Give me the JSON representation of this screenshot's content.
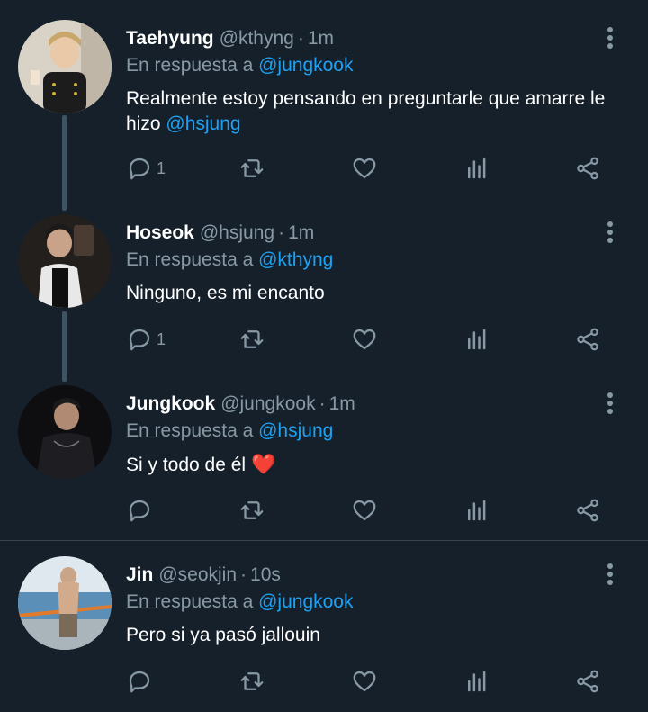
{
  "tweets": [
    {
      "name": "Taehyung",
      "handle": "@kthyng",
      "time": "1m",
      "reply_prefix": "En respuesta a",
      "reply_to": "@jungkook",
      "text_main": "Realmente estoy pensando en preguntarle que amarre le hizo",
      "text_mention": "@hsjung",
      "reply_count": "1"
    },
    {
      "name": "Hoseok",
      "handle": "@hsjung",
      "time": "1m",
      "reply_prefix": "En respuesta a",
      "reply_to": "@kthyng",
      "text_main": "Ninguno, es mi encanto",
      "reply_count": "1"
    },
    {
      "name": "Jungkook",
      "handle": "@jungkook",
      "time": "1m",
      "reply_prefix": "En respuesta a",
      "reply_to": "@hsjung",
      "text_main": "Si y todo de él",
      "emoji": "❤️"
    },
    {
      "name": "Jin",
      "handle": "@seokjin",
      "time": "10s",
      "reply_prefix": "En respuesta a",
      "reply_to": "@jungkook",
      "text_main": "Pero si ya pasó jallouin"
    }
  ],
  "separator": "·",
  "colors": {
    "background": "#15202b",
    "muted": "#8899a6",
    "link": "#1da1f2",
    "thread_line": "#3d5466"
  }
}
